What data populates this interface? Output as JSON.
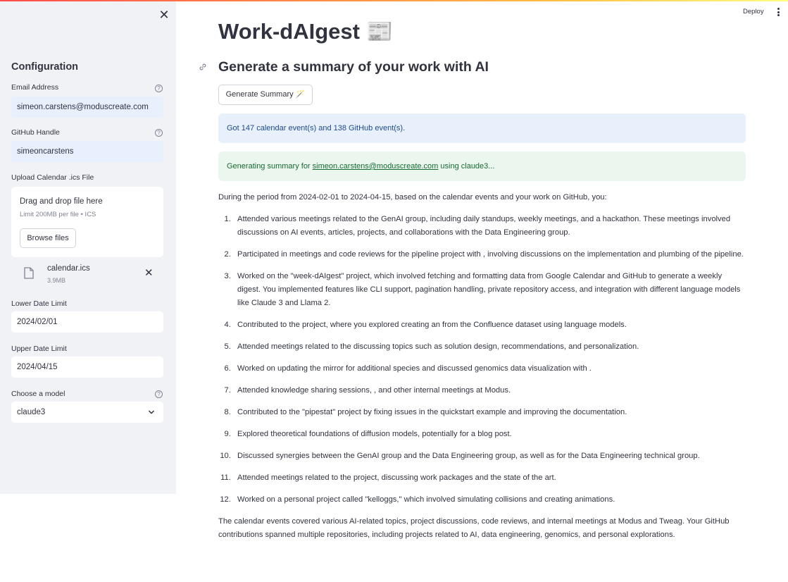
{
  "header": {
    "deploy_label": "Deploy"
  },
  "sidebar": {
    "title": "Configuration",
    "email": {
      "label": "Email Address",
      "value": "simeon.carstens@moduscreate.com"
    },
    "github": {
      "label": "GitHub Handle",
      "value": "simeoncarstens"
    },
    "upload": {
      "label": "Upload Calendar .ics File",
      "drop_text": "Drag and drop file here",
      "limit_text": "Limit 200MB per file • ICS",
      "browse_label": "Browse files",
      "file_name": "calendar.ics",
      "file_size": "3.9MB"
    },
    "lower_date": {
      "label": "Lower Date Limit",
      "value": "2024/02/01"
    },
    "upper_date": {
      "label": "Upper Date Limit",
      "value": "2024/04/15"
    },
    "model": {
      "label": "Choose a model",
      "value": "claude3"
    }
  },
  "main": {
    "title": "Work-dAIgest 📰",
    "subheader": "Generate a summary of your work with AI",
    "generate_button": "Generate Summary 🪄",
    "info_alert": "Got 147 calendar event(s) and 138 GitHub event(s).",
    "success_prefix": "Generating summary for ",
    "success_email": "simeon.carstens@moduscreate.com",
    "success_suffix": " using claude3...",
    "intro": "During the period from 2024-02-01 to 2024-04-15, based on the calendar events and your work on GitHub, you:",
    "items": [
      "Attended various meetings related to the GenAI group, including daily standups, weekly meetings, and a hackathon. These meetings involved discussions on AI events, articles, projects, and collaborations with the Data Engineering group.",
      "Participated in meetings and code reviews for the pipeline project with , involving discussions on the implementation and plumbing of the pipeline.",
      "Worked on the \"week-dAIgest\" project, which involved fetching and formatting data from Google Calendar and GitHub to generate a weekly digest. You implemented features like CLI support, pagination handling, private repository access, and integration with different language models like Claude 3 and Llama 2.",
      "Contributed to the project, where you explored creating an from the Confluence dataset using language models.",
      "Attended meetings related to the discussing topics such as solution design, recommendations, and personalization.",
      "Worked on updating the mirror for additional species and discussed genomics data visualization with .",
      "Attended knowledge sharing sessions, , and other internal meetings at Modus.",
      "Contributed to the \"pipestat\" project by fixing issues in the quickstart example and improving the documentation.",
      "Explored theoretical foundations of diffusion models, potentially for a blog post.",
      "Discussed synergies between the GenAI group and the Data Engineering group, as well as for the Data Engineering technical group.",
      "Attended meetings related to the project, discussing work packages and the state of the art.",
      "Worked on a personal project called \"kelloggs,\" which involved simulating collisions and creating animations."
    ],
    "closing": "The calendar events covered various AI-related topics, project discussions, code reviews, and internal meetings at Modus and Tweag. Your GitHub contributions spanned multiple repositories, including projects related to AI, data engineering, genomics, and personal explorations."
  }
}
